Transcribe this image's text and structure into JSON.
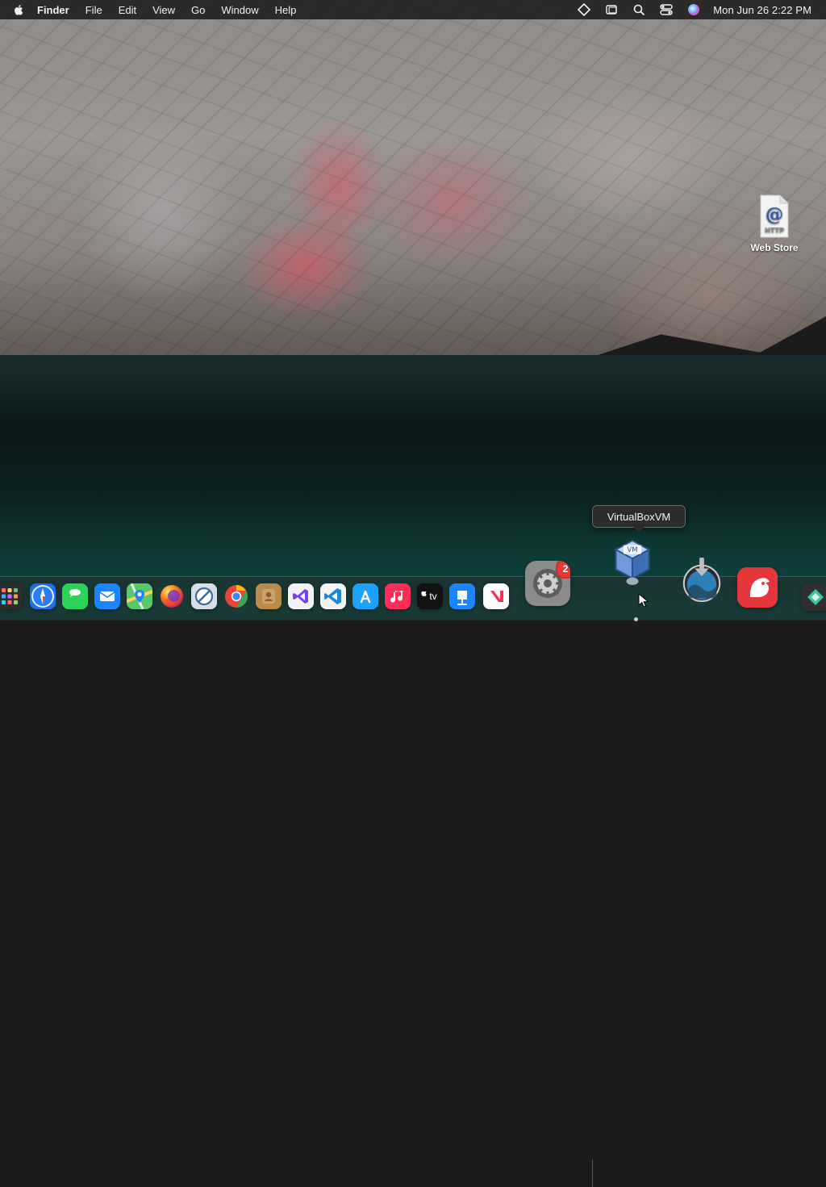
{
  "menubar": {
    "app_name": "Finder",
    "menus": [
      "File",
      "Edit",
      "View",
      "Go",
      "Window",
      "Help"
    ],
    "clock": "Mon Jun 26  2:22 PM",
    "status_icons": [
      "diamond-icon",
      "screen-mirroring-icon",
      "spotlight-search-icon",
      "control-center-icon",
      "siri-icon"
    ]
  },
  "desktop": {
    "file": {
      "label": "Web Store",
      "icon_text": "HTTP",
      "icon_symbol": "@"
    }
  },
  "tooltip": {
    "text": "VirtualBoxVM"
  },
  "dock": {
    "apps": [
      {
        "name": "launchpad"
      },
      {
        "name": "safari"
      },
      {
        "name": "messages"
      },
      {
        "name": "mail"
      },
      {
        "name": "maps"
      },
      {
        "name": "firefox"
      },
      {
        "name": "no-entry"
      },
      {
        "name": "chrome"
      },
      {
        "name": "contacts"
      },
      {
        "name": "visual-studio"
      },
      {
        "name": "vs-code"
      },
      {
        "name": "app-store"
      },
      {
        "name": "music"
      },
      {
        "name": "apple-tv",
        "label": "tv"
      },
      {
        "name": "keynote"
      },
      {
        "name": "news"
      },
      {
        "name": "system-settings",
        "badge": "2"
      },
      {
        "name": "virtualbox-vm"
      },
      {
        "name": "downloads"
      },
      {
        "name": "bear"
      },
      {
        "name": "partial-app"
      }
    ],
    "colors": {
      "dock_bg": "#282828",
      "badge_red": "#e53935"
    }
  }
}
